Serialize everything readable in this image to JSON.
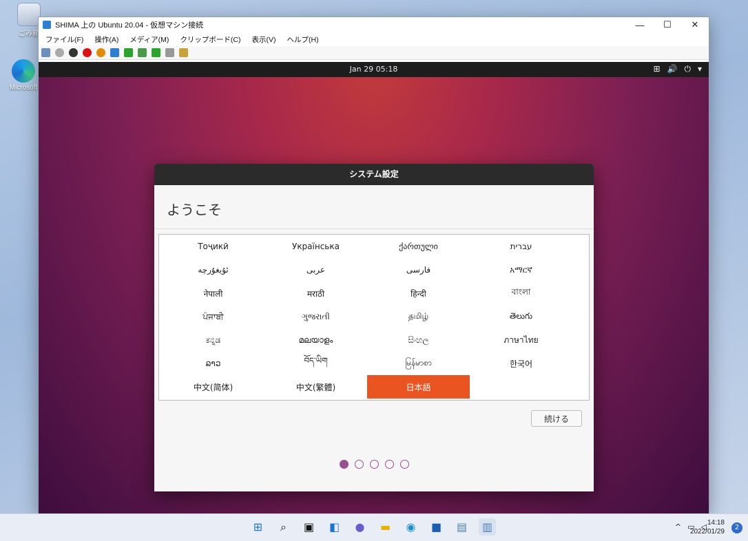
{
  "desktop": {
    "icons": [
      {
        "label": "ごみ箱",
        "icon": "recycle-bin-icon"
      },
      {
        "label": "Microsoft",
        "icon": "edge-icon"
      }
    ]
  },
  "vm": {
    "title": "SHIMA 上の Ubuntu 20.04 - 仮想マシン接続",
    "menu": [
      "ファイル(F)",
      "操作(A)",
      "メディア(M)",
      "クリップボード(C)",
      "表示(V)",
      "ヘルプ(H)"
    ],
    "window_buttons": {
      "minimize": "—",
      "maximize": "☐",
      "close": "✕"
    }
  },
  "ubuntu": {
    "clock": "Jan 29  05:18",
    "tray": {
      "network": "⊞",
      "volume": "🔊",
      "power": "⏻",
      "menu": "▾"
    }
  },
  "dialog": {
    "title": "システム設定",
    "heading": "ようこそ",
    "languages": [
      "Тоҷикӣ",
      "Українська",
      "ქართული",
      "עברית",
      "ئۇيغۇرچە",
      "عربى",
      "فارسی",
      "አማርኛ",
      "नेपाली",
      "मराठी",
      "हिन्दी",
      "বাংলা",
      "ਪੰਜਾਬੀ",
      "ગુજરાતી",
      "தமிழ்",
      "తెలుగు",
      "ಕನ್ನಡ",
      "മലയാളം",
      "සිංහල",
      "ภาษาไทย",
      "ລາວ",
      "བོད་ཡིག",
      "မြန်မာစာ",
      "한국어",
      "中文(简体)",
      "中文(繁體)",
      "日本語",
      ""
    ],
    "selected_language": "日本語",
    "continue_label": "続ける",
    "steps_total": 5,
    "step_current": 1
  },
  "taskbar": {
    "apps": [
      "start-icon",
      "search-icon",
      "task-view-icon",
      "widgets-icon",
      "chat-icon",
      "file-explorer-icon",
      "edge-icon",
      "store-icon",
      "hyperv-manager-icon",
      "vm-connection-icon"
    ],
    "time": "14:18",
    "date": "2022/01/29",
    "notifications": "2",
    "accent": "#e95420"
  }
}
